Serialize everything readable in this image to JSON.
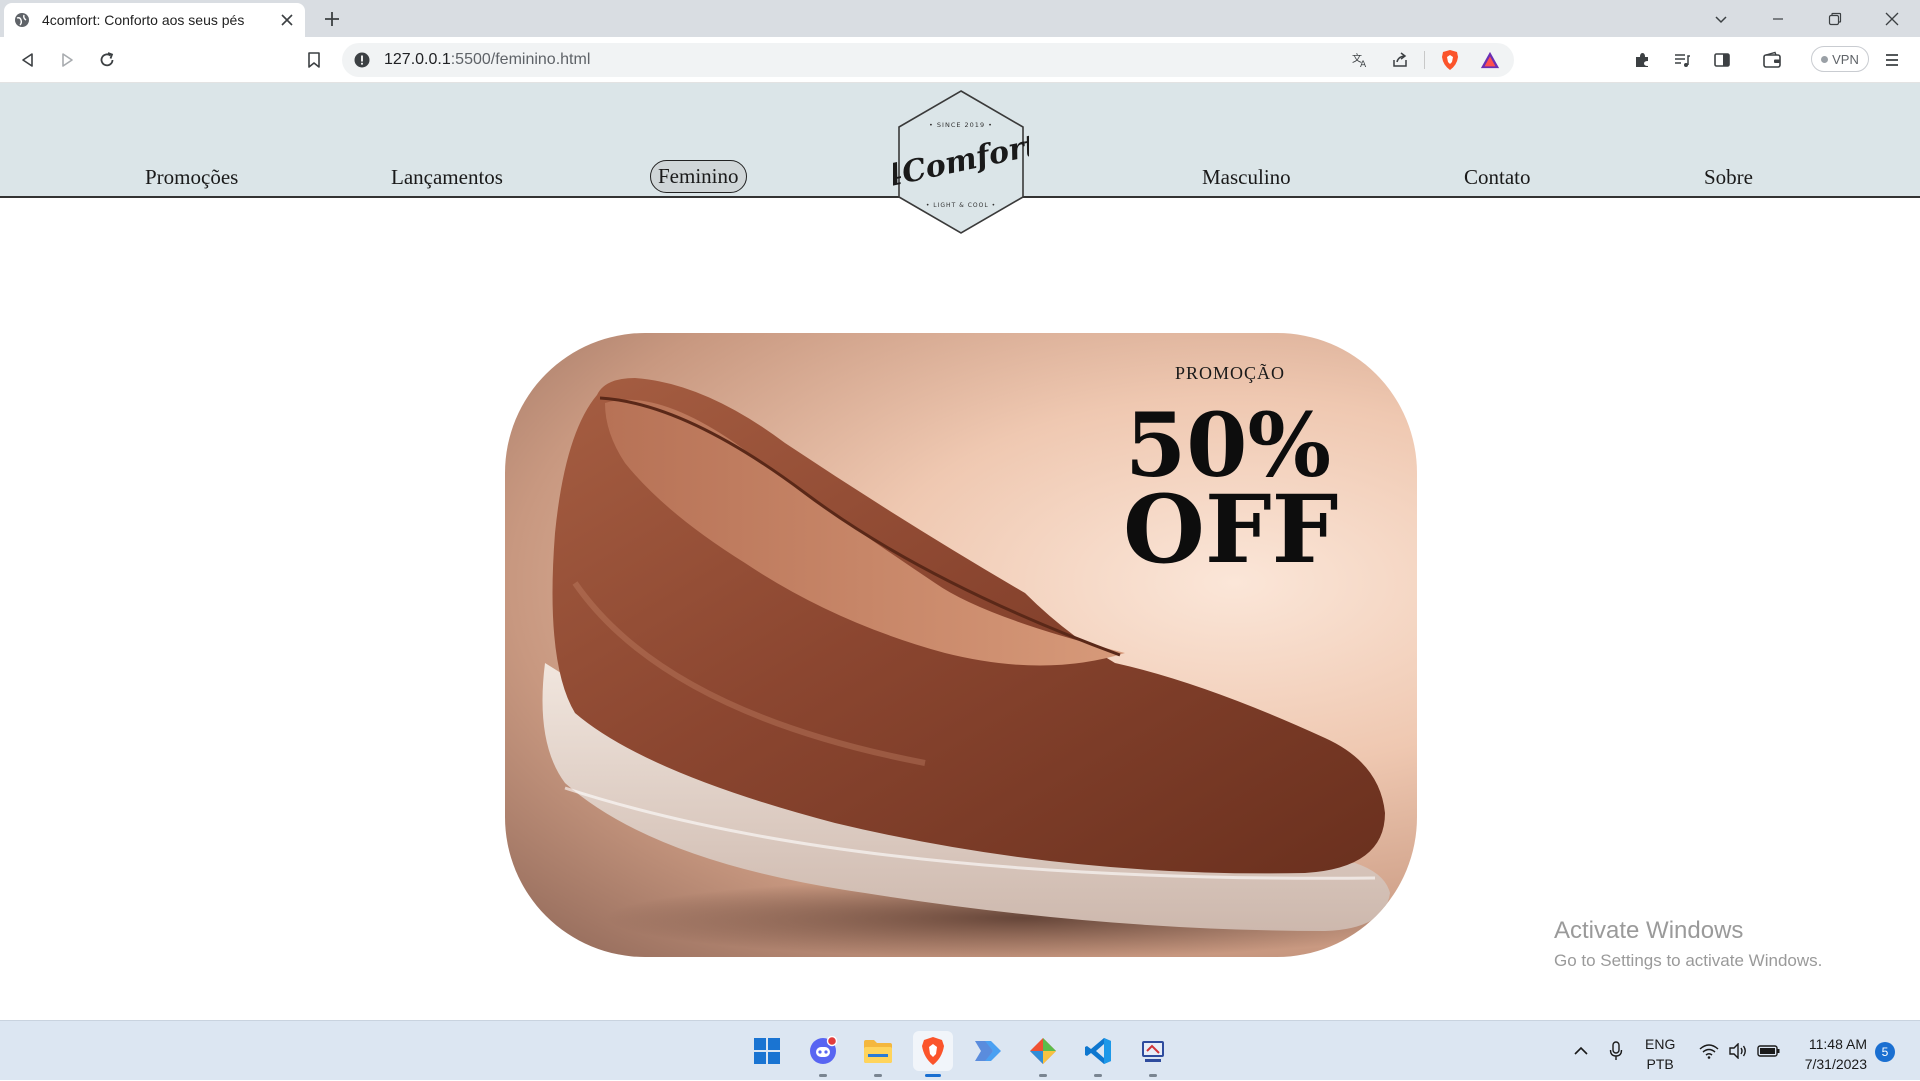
{
  "browser": {
    "tab_title": "4comfort: Conforto aos seus pés",
    "url_host": "127.0.0.1",
    "url_rest": ":5500/feminino.html",
    "vpn_label": "VPN"
  },
  "site": {
    "nav": [
      {
        "label": "Promoções"
      },
      {
        "label": "Lançamentos"
      },
      {
        "label": "Feminino",
        "active": true
      },
      {
        "label": "Masculino"
      },
      {
        "label": "Contato"
      },
      {
        "label": "Sobre"
      }
    ],
    "logo": {
      "name": "4Comfort",
      "top_text": "• SINCE 2019 •",
      "bottom_text": "• LIGHT & COOL •"
    },
    "hero": {
      "kicker": "PROMOÇÃO",
      "discount": "50%",
      "off": "OFF"
    }
  },
  "watermark": {
    "title": "Activate Windows",
    "subtitle": "Go to Settings to activate Windows."
  },
  "taskbar": {
    "lang_top": "ENG",
    "lang_bottom": "PTB",
    "time": "11:48 AM",
    "date": "7/31/2023",
    "notification_count": "5"
  },
  "colors": {
    "header_bg": "#dbe5e8",
    "accent": "#1a6fd1"
  }
}
